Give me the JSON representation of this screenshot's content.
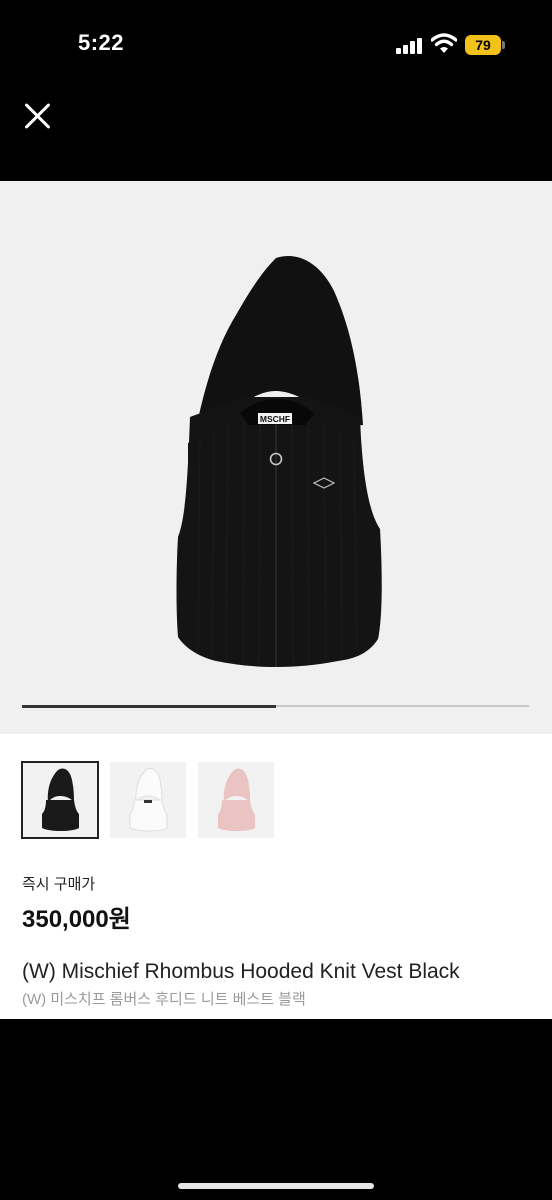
{
  "status": {
    "time": "5:22",
    "battery": "79",
    "battery_color": "#f2c21a"
  },
  "toolbar": {
    "close_icon": "close-icon"
  },
  "gallery": {
    "main_image": {
      "product_color": "#111111",
      "background": "#f0f0f0",
      "logo_text": "MSCHF"
    },
    "progress": 0.5,
    "thumbnails": [
      {
        "color": "#1a1a1a",
        "selected": true
      },
      {
        "color": "#f7f7f7",
        "selected": false
      },
      {
        "color": "#e9c4c2",
        "selected": false
      }
    ]
  },
  "product": {
    "price_label": "즉시 구매가",
    "price": "350,000원",
    "title_en": "(W) Mischief Rhombus Hooded Knit Vest Black",
    "title_ko": "(W) 미스치프 롬버스 후디드 니트 베스트 블랙"
  }
}
